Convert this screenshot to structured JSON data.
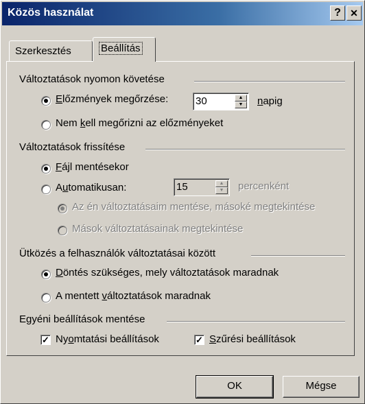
{
  "window": {
    "title": "Közös használat",
    "help_button": "?",
    "close_button": "✕"
  },
  "tabs": [
    {
      "label": "Szerkesztés",
      "active": false
    },
    {
      "label": "Beállítás",
      "active": true
    }
  ],
  "tracking": {
    "group_title": "Változtatások nyomon követése",
    "keep_history": {
      "label_pre": "",
      "accel": "E",
      "label_post": "lőzmények megőrzése:",
      "checked": true
    },
    "days_value": "30",
    "days_unit_accel": "n",
    "days_unit_rest": "apig",
    "no_history": {
      "label_pre": "Nem ",
      "accel": "k",
      "label_post": "ell megőrizni az előzményeket",
      "checked": false
    }
  },
  "update": {
    "group_title": "Változtatások frissítése",
    "on_save": {
      "accel": "F",
      "label_post": "ájl mentésekor",
      "checked": true
    },
    "automatic": {
      "label_pre": "A",
      "accel": "u",
      "label_post": "tomatikusan:",
      "checked": false
    },
    "minutes_value": "15",
    "minutes_unit": "percenként",
    "save_mine_view_others": {
      "label": "Az én változtatásaim mentése, másoké megtekintése",
      "checked": true,
      "disabled": true
    },
    "view_others": {
      "label": "Mások változtatásainak megtekintése",
      "checked": false,
      "disabled": true
    }
  },
  "conflict": {
    "group_title": "Ütközés a felhasználók változtatásai között",
    "ask": {
      "accel": "D",
      "label_post": "öntés szükséges, mely változtatások maradnak",
      "checked": true
    },
    "saved_win": {
      "label_pre": "A mentett ",
      "accel": "v",
      "label_post": "áltoztatások maradnak",
      "checked": false
    }
  },
  "personal": {
    "group_title": "Egyéni beállítások mentése",
    "print": {
      "label_pre": "Ny",
      "accel": "o",
      "label_post": "mtatási beállítások",
      "checked": true
    },
    "filter": {
      "accel": "S",
      "label_post": "zűrési beállítások",
      "checked": true
    }
  },
  "buttons": {
    "ok": "OK",
    "cancel": "Mégse"
  }
}
